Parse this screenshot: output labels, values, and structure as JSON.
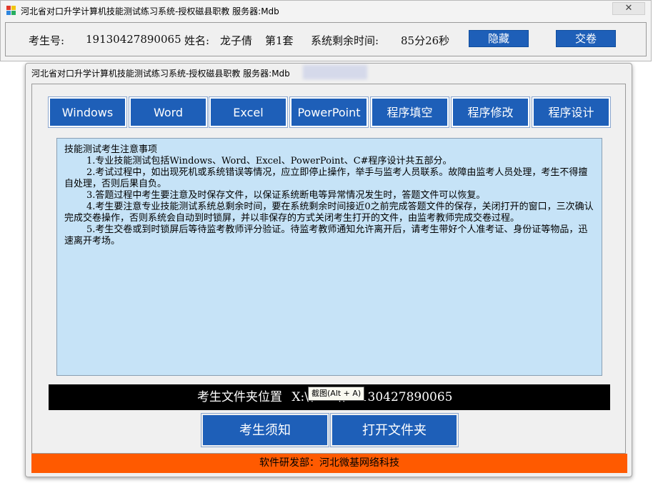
{
  "top_window": {
    "title": "河北省对口升学计算机技能测试练习系统-授权磁县职教  服务器:Mdb",
    "close_label": "✕",
    "student_id_label": "考生号:",
    "student_id": "19130427890065",
    "name_label": "姓名:",
    "name": "龙子倩",
    "set": "第1套",
    "time_label": "系统剩余时间:",
    "time_value": "85分26秒",
    "hide_label": "隐藏",
    "submit_label": "交卷"
  },
  "main_window": {
    "title": "河北省对口升学计算机技能测试练习系统-授权磁县职教  服务器:Mdb",
    "tabs": [
      {
        "label": "Windows"
      },
      {
        "label": "Word"
      },
      {
        "label": "Excel"
      },
      {
        "label": "PowerPoint"
      },
      {
        "label": "程序填空"
      },
      {
        "label": "程序修改"
      },
      {
        "label": "程序设计"
      }
    ],
    "notice": {
      "heading": "技能测试考生注意事项",
      "items": [
        "1.专业技能测试包括Windows、Word、Excel、PowerPoint、C#程序设计共五部分。",
        "2.考试过程中，如出现死机或系统错误等情况，应立即停止操作，举手与监考人员联系。故障由监考人员处理，考生不得擅自处理，否则后果自负。",
        "3.答题过程中考生要注意及时保存文件，以保证系统断电等异常情况发生时，答题文件可以恢复。",
        "4.考生要注意专业技能测试系统总剩余时间，要在系统剩余时间接近0之前完成答题文件的保存，关闭打开的窗口，三次确认完成交卷操作，否则系统会自动到时锁屏，并以非保存的方式关闭考生打开的文件，由监考教师完成交卷过程。",
        "5.考生交卷或到时锁屏后等待监考教师评分验证。待监考教师通知允许离开后，请考生带好个人准考证、身份证等物品，迅速离开考场。"
      ]
    },
    "folder_label": "考生文件夹位置",
    "folder_path": "X:\\\\Bak\\\\19130427890065",
    "tooltip": "截图(Alt + A)",
    "notice_button": "考生须知",
    "open_folder_button": "打开文件夹",
    "footer": "软件研发部：河北微基网络科技"
  },
  "colors": {
    "button_blue": "#1e5fb8",
    "notice_bg": "#c6e3f7",
    "footer_orange": "#ff5a00"
  }
}
